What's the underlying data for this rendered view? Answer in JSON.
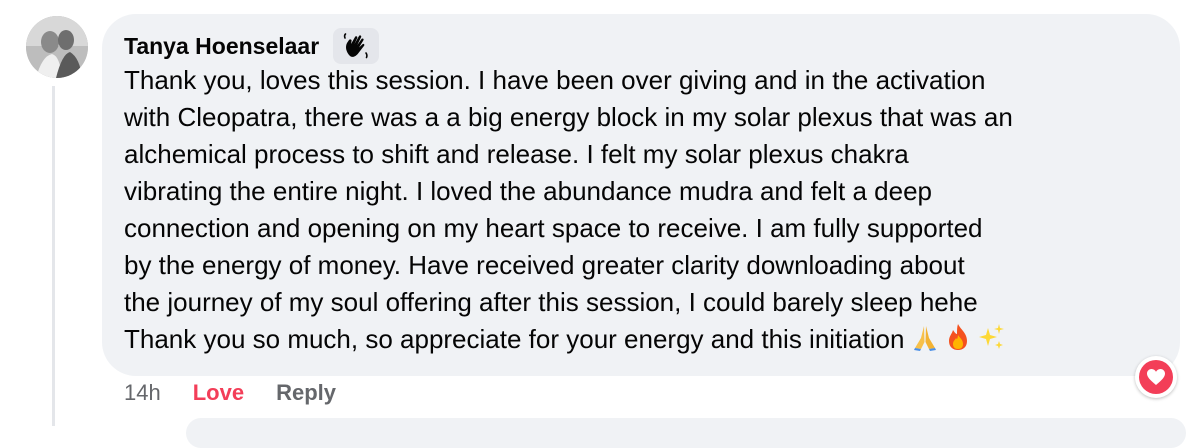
{
  "comment": {
    "author": "Tanya Hoenselaar",
    "author_badge_icon": "waving-hand-icon",
    "text_lines": [
      "Thank you, loves this session. I have been over giving and in the activation",
      "with Cleopatra, there was a a big energy block in my solar plexus that was an",
      "alchemical process to shift and release. I felt my solar plexus chakra",
      "vibrating the entire night. I loved the abundance mudra and felt a deep",
      "connection and opening on my heart space to receive. I am fully supported",
      "by the energy of money. Have received greater clarity downloading about",
      "the journey of my soul offering after this session, I could barely sleep hehe",
      "Thank you so much, so appreciate for your energy and this initiation"
    ],
    "trailing_emojis": [
      "folded-hands-emoji",
      "fire-emoji",
      "sparkles-emoji"
    ],
    "reaction_icon": "love-heart-icon"
  },
  "actions": {
    "timestamp": "14h",
    "love_label": "Love",
    "reply_label": "Reply"
  },
  "colors": {
    "bubble": "#f0f2f5",
    "love": "#f33e58",
    "muted": "#65676b",
    "text": "#050505"
  }
}
